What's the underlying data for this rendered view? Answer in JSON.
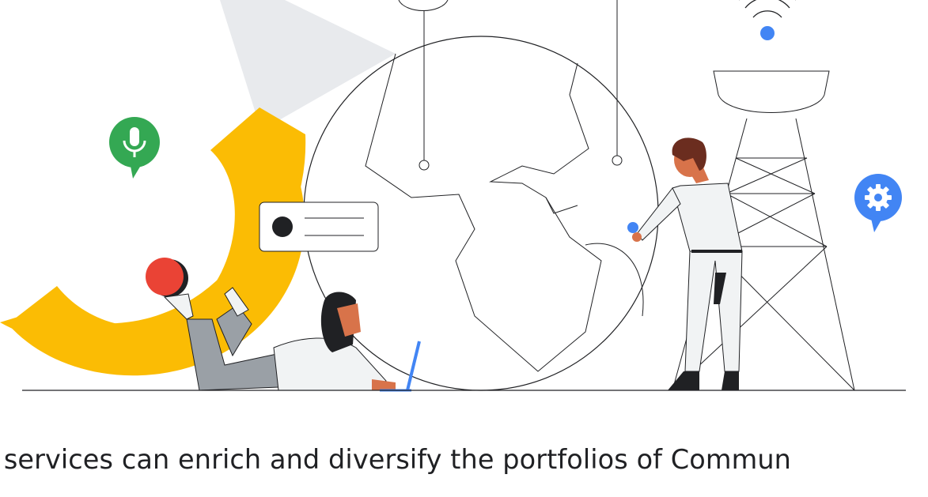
{
  "caption": {
    "line1": "ge services can enrich and diversify the portfolios of Commun",
    "line2": "                                                               "
  },
  "illustration": {
    "icons": [
      "microphone-icon",
      "gear-icon",
      "wifi-signal-icon",
      "laptop-icon"
    ],
    "colors": {
      "yellow_arc": "#fbbc04",
      "red_ball": "#ea4335",
      "green_mic": "#34a853",
      "blue_accent": "#4285f4",
      "gray_beam": "#e8eaed",
      "line": "#202124",
      "skin_tan": "#d8734a",
      "hair_dark": "#202124",
      "hair_brown": "#6b2d1f",
      "pants_gray": "#9aa0a6",
      "pants_light": "#f1f3f4"
    }
  }
}
